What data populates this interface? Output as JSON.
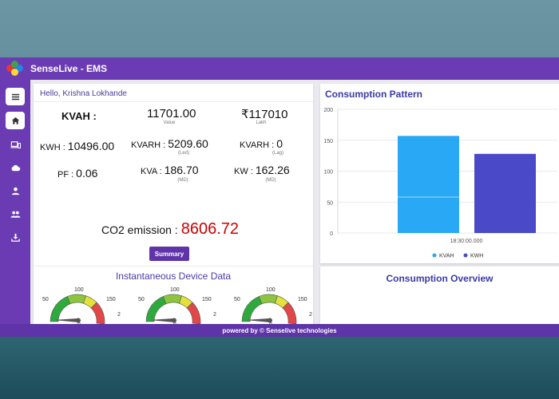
{
  "app": {
    "title": "SenseLive - EMS",
    "footer": "powered by © Senselive technologies"
  },
  "sidebar": {
    "items": [
      {
        "name": "menu",
        "icon": "menu-icon"
      },
      {
        "name": "home",
        "icon": "home-icon",
        "active": true
      },
      {
        "name": "devices",
        "icon": "devices-icon"
      },
      {
        "name": "cloud",
        "icon": "cloud-icon"
      },
      {
        "name": "user",
        "icon": "person-icon"
      },
      {
        "name": "group",
        "icon": "group-icon"
      },
      {
        "name": "download",
        "icon": "download-icon"
      }
    ]
  },
  "dashboard": {
    "greeting": "Hello, Krishna Lokhande",
    "kvah": {
      "label": "KVAH :",
      "value": "11701.00",
      "sub": "Value"
    },
    "cost": {
      "value": "₹117010",
      "sub": "Lakh"
    },
    "kwh": {
      "label": "KWH :",
      "value": "10496.00"
    },
    "kvarh_led": {
      "label": "KVARH :",
      "value": "5209.60",
      "sub": "(Led)"
    },
    "kvarh_lag": {
      "label": "KVARH :",
      "value": "0",
      "sub": "(Lag)"
    },
    "pf": {
      "label": "PF :",
      "value": "0.06"
    },
    "kva": {
      "label": "KVA :",
      "value": "186.70",
      "sub": "(MD)"
    },
    "kw": {
      "label": "KW :",
      "value": "162.26",
      "sub": "(MD)"
    },
    "co2": {
      "label": "CO2 emission :",
      "value": "8606.72"
    },
    "summary_label": "Summary",
    "instantaneous_title": "Instantaneous Device Data",
    "gauges": [
      {
        "ticks": [
          "50",
          "100",
          "150",
          "2"
        ],
        "value_label": "0"
      },
      {
        "ticks": [
          "50",
          "100",
          "150",
          "2"
        ],
        "value_label": "0"
      },
      {
        "ticks": [
          "50",
          "100",
          "150",
          "2"
        ],
        "value_label": "0"
      }
    ]
  },
  "consumption": {
    "pattern_title": "Consumption Pattern",
    "overview_title": "Consumption Overview"
  },
  "colors": {
    "brand": "#6a3bb3",
    "kvah": "#29a8f5",
    "kwh": "#4a4ac8",
    "co2": "#cc0000"
  },
  "chart_data": {
    "type": "bar",
    "categories": [
      "18:30:00.000"
    ],
    "series": [
      {
        "name": "KVAH",
        "values": [
          157
        ]
      },
      {
        "name": "KWH",
        "values": [
          128
        ]
      }
    ],
    "yticks": [
      "0",
      "50",
      "100",
      "150",
      "200"
    ],
    "ylim": [
      0,
      200
    ],
    "legend": "bottom",
    "grid": true
  }
}
